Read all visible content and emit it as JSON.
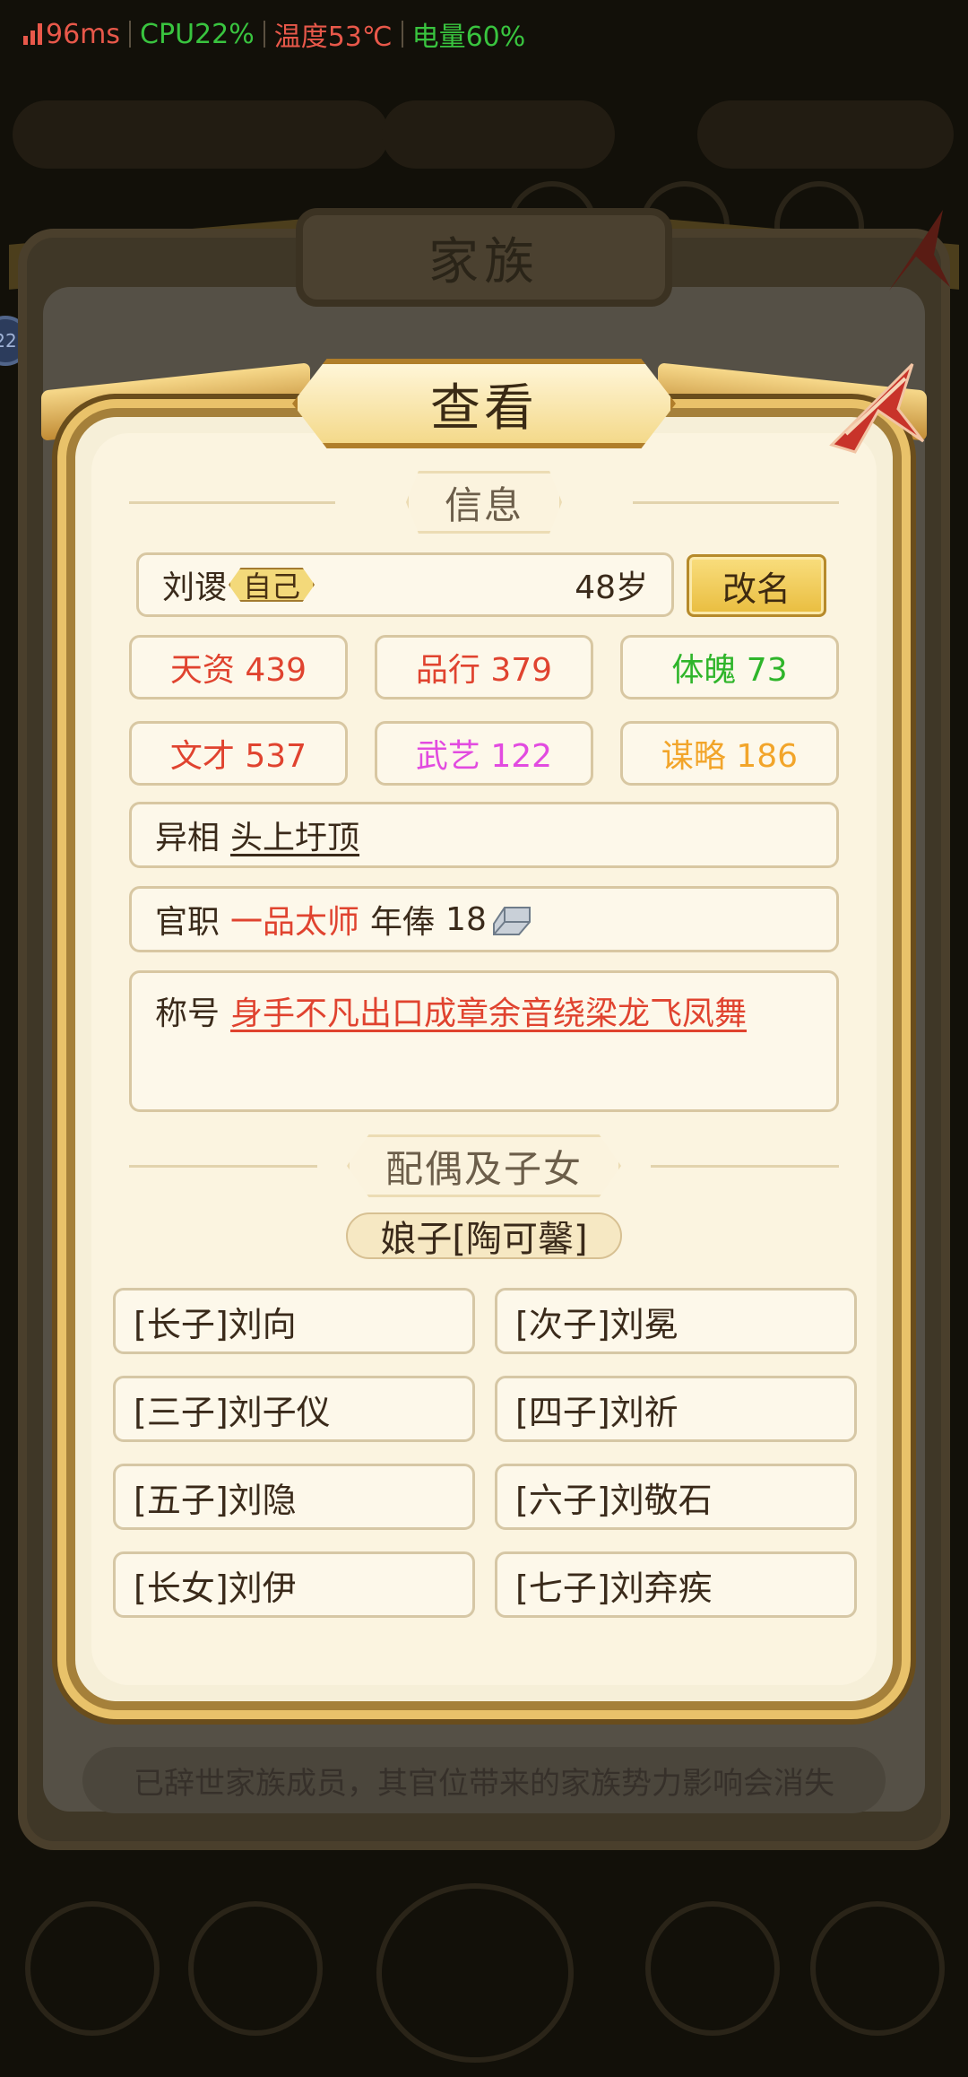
{
  "perf": {
    "latency": "96ms",
    "cpu": "CPU22%",
    "temp": "温度53℃",
    "battery": "电量60%",
    "colors": {
      "latency": "#e8584a",
      "cpu": "#39c43f",
      "temp": "#e8584a",
      "battery": "#39c43f"
    }
  },
  "background": {
    "family_title": "家族",
    "notice": "已辞世家族成员，其官位带来的家族势力影响会消失",
    "badge": "22"
  },
  "dialog": {
    "title": "查看",
    "info_section": "信息",
    "person": {
      "name": "刘谡",
      "tag": "自己",
      "age": "48岁"
    },
    "rename_label": "改名",
    "stats": [
      {
        "label": "天资 439",
        "color": "red"
      },
      {
        "label": "品行 379",
        "color": "red"
      },
      {
        "label": "体魄 73",
        "color": "green"
      },
      {
        "label": "文才 537",
        "color": "red"
      },
      {
        "label": "武艺 122",
        "color": "magenta"
      },
      {
        "label": "谋略 186",
        "color": "orange"
      }
    ],
    "trait": {
      "label": "异相",
      "value": "头上圩顶"
    },
    "office": {
      "label": "官职",
      "value": "一品太师",
      "salary_label": "年俸",
      "salary_value": "18",
      "salary_icon": "silver-ingot-icon"
    },
    "title_row": {
      "label": "称号",
      "value": "身手不凡出口成章余音绕梁龙飞凤舞"
    },
    "family_section": "配偶及子女",
    "spouse": "娘子[陶可馨]",
    "children": [
      "[长子]刘向",
      "[次子]刘冕",
      "[三子]刘子仪",
      "[四子]刘祈",
      "[五子]刘隐",
      "[六子]刘敬石",
      "[长女]刘伊",
      "[七子]刘弃疾"
    ],
    "close_icon": "close-icon"
  }
}
